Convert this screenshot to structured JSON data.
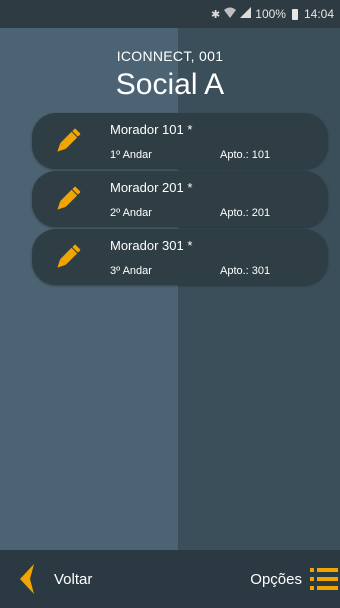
{
  "status_bar": {
    "bluetooth_icon": "bluetooth-icon",
    "wifi_icon": "wifi-icon",
    "signal_icon": "signal-icon",
    "battery_percent": "100%",
    "time": "14:04"
  },
  "header": {
    "subtitle": "ICONNECT, 001",
    "title": "Social A"
  },
  "residents": [
    {
      "name": "Morador 101 *",
      "floor": "1º Andar",
      "apartment": "Apto.: 101",
      "icon": "pencil-icon"
    },
    {
      "name": "Morador 201 *",
      "floor": "2º Andar",
      "apartment": "Apto.: 201",
      "icon": "pencil-icon"
    },
    {
      "name": "Morador 301 *",
      "floor": "3º Andar",
      "apartment": "Apto.: 301",
      "icon": "pencil-icon"
    }
  ],
  "bottom_bar": {
    "back_label": "Voltar",
    "options_label": "Opções",
    "back_icon": "chevron-left-icon",
    "options_icon": "list-icon"
  },
  "colors": {
    "accent": "#f0a500",
    "bar": "#2b3a42",
    "item_bg": "#2f3e45"
  }
}
